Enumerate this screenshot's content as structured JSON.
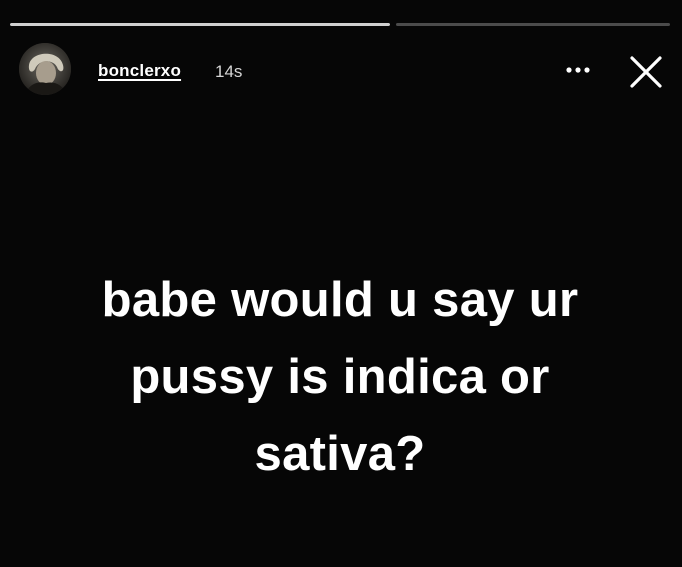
{
  "story": {
    "progress": [
      {
        "fill_fraction": 1.0
      },
      {
        "fill_fraction": 0.0
      }
    ],
    "header": {
      "username": "bonclerxo",
      "timestamp": "14s",
      "more_icon": "more-horizontal-icon",
      "close_icon": "close-icon"
    },
    "caption": {
      "lines": [
        "babe would u say ur",
        "pussy is indica or",
        "sativa?"
      ]
    }
  },
  "colors": {
    "background": "#060606",
    "text": "#ffffff",
    "progress_track": "#474747",
    "progress_fill": "#cfcfcf"
  }
}
